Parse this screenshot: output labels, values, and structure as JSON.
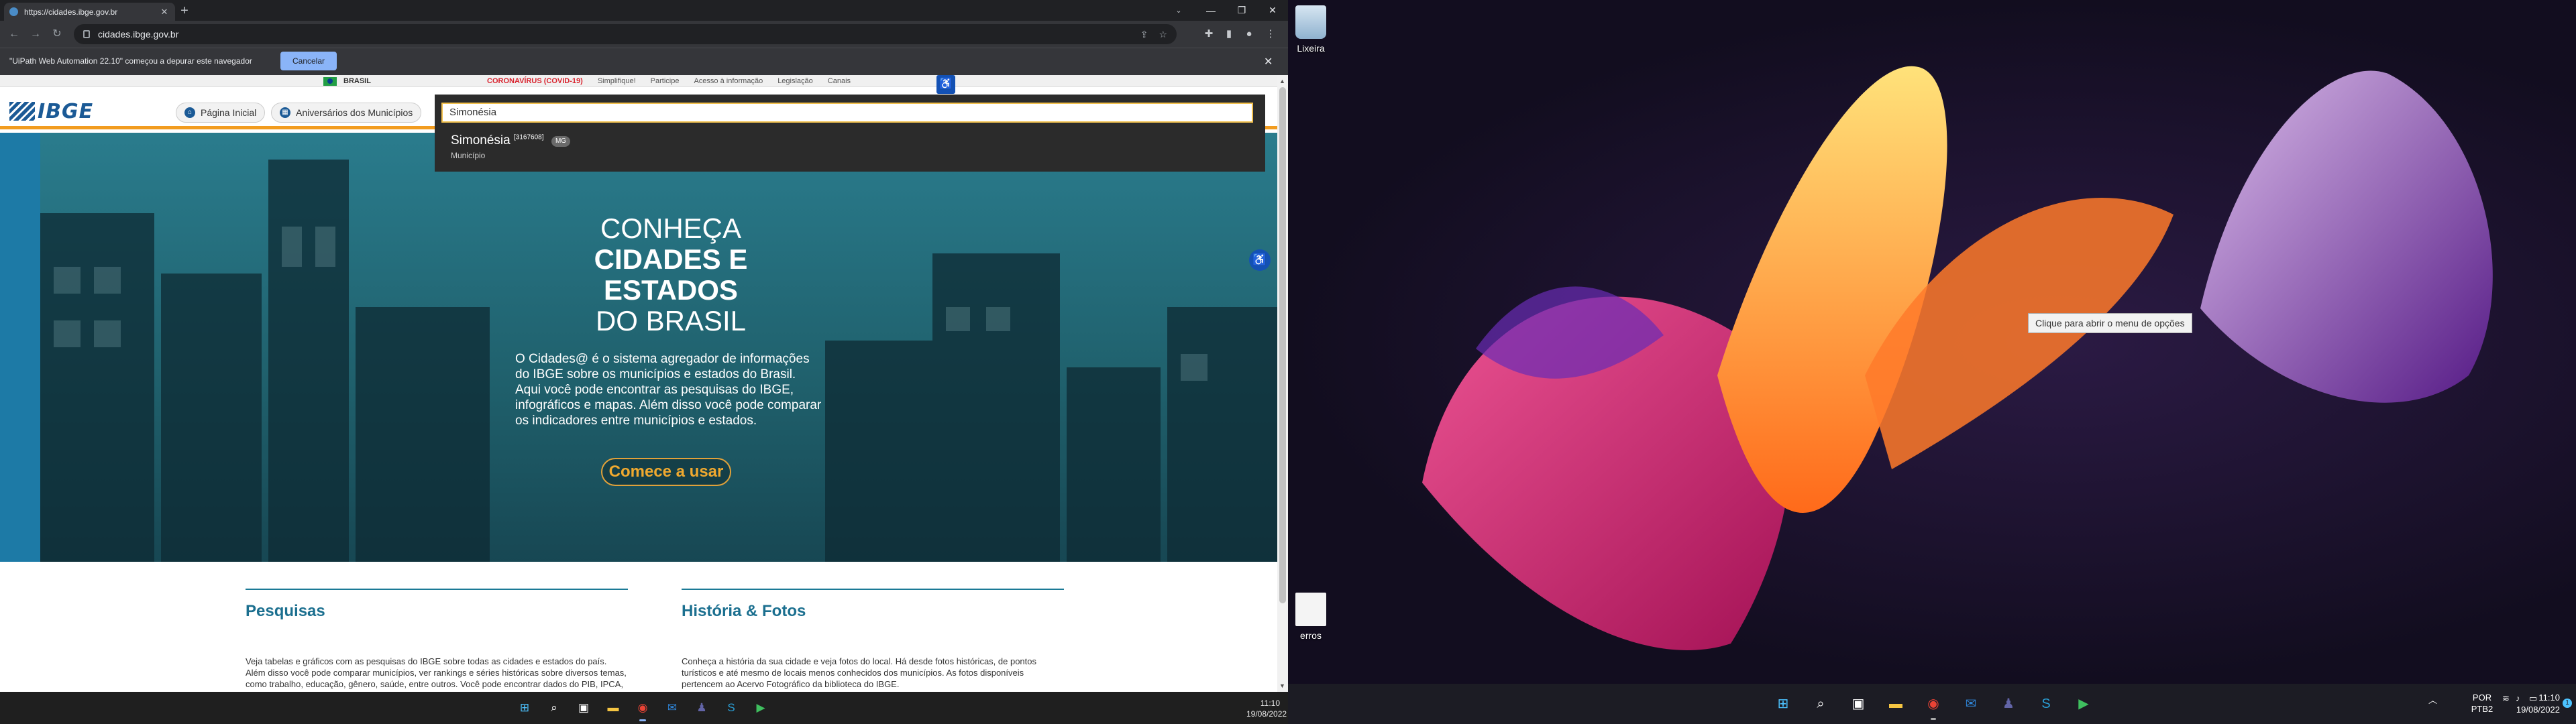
{
  "browser": {
    "tab_title": "https://cidades.ibge.gov.br",
    "url": "cidades.ibge.gov.br",
    "infobar_message": "\"UiPath Web Automation 22.10\" começou a depurar este navegador",
    "infobar_cancel": "Cancelar"
  },
  "gov_bar": {
    "brasil": "BRASIL",
    "links": [
      "CORONAVÍRUS (COVID-19)",
      "Simplifique!",
      "Participe",
      "Acesso à informação",
      "Legislação",
      "Canais"
    ]
  },
  "site": {
    "logo": "IBGE",
    "home_button": "Página Inicial",
    "anniversaries_button": "Aniversários dos Municípios"
  },
  "search": {
    "value": "Simonésia",
    "suggestion_name": "Simonésia",
    "suggestion_code": "[3167608]",
    "suggestion_uf": "MG",
    "suggestion_type": "Município"
  },
  "hero": {
    "line1": "CONHEÇA",
    "line2": "CIDADES E",
    "line3": "ESTADOS",
    "line4": "DO BRASIL",
    "description": "O Cidades@ é o sistema agregador de informações do IBGE sobre os municípios e estados do Brasil. Aqui você pode encontrar as pesquisas do IBGE, infográficos e mapas. Além disso você pode comparar os indicadores entre municípios e estados.",
    "cta": "Comece a usar"
  },
  "sections": {
    "pesquisas_title": "Pesquisas",
    "pesquisas_text": "Veja tabelas e gráficos com as pesquisas do IBGE sobre todas as cidades e estados do país. Além disso você pode comparar municípios, ver rankings e séries históricas sobre diversos temas, como trabalho, educação, gênero, saúde, entre outros. Você pode encontrar dados do PIB, IPCA, IDH, Censo e de diversas outras pesquisas.",
    "historia_title": "História & Fotos",
    "historia_text": "Conheça a história da sua cidade e veja fotos do local. Há desde fotos históricas, de pontos turísticos e até mesmo de locais menos conhecidos dos municípios. As fotos disponíveis pertencem ao Acervo Fotográfico da biblioteca do IBGE."
  },
  "left_taskbar": {
    "time": "11:10",
    "date": "19/08/2022"
  },
  "desktop": {
    "recycle_bin": "Lixeira",
    "file_label": "erros",
    "tooltip": "Clique para abrir o menu de opções",
    "lang_line1": "POR",
    "lang_line2": "PTB2",
    "time": "11:10",
    "date": "19/08/2022",
    "notification_count": "1"
  },
  "icons": {
    "search": "search-icon",
    "star": "star-icon",
    "extensions": "puzzle-icon",
    "menu": "kebab-menu-icon"
  },
  "colors": {
    "ibge_blue": "#1b5a96",
    "ibge_orange": "#f29c1f",
    "covid_red": "#d9232e",
    "chrome_dark": "#202124",
    "cta_orange": "#f0a92f"
  }
}
